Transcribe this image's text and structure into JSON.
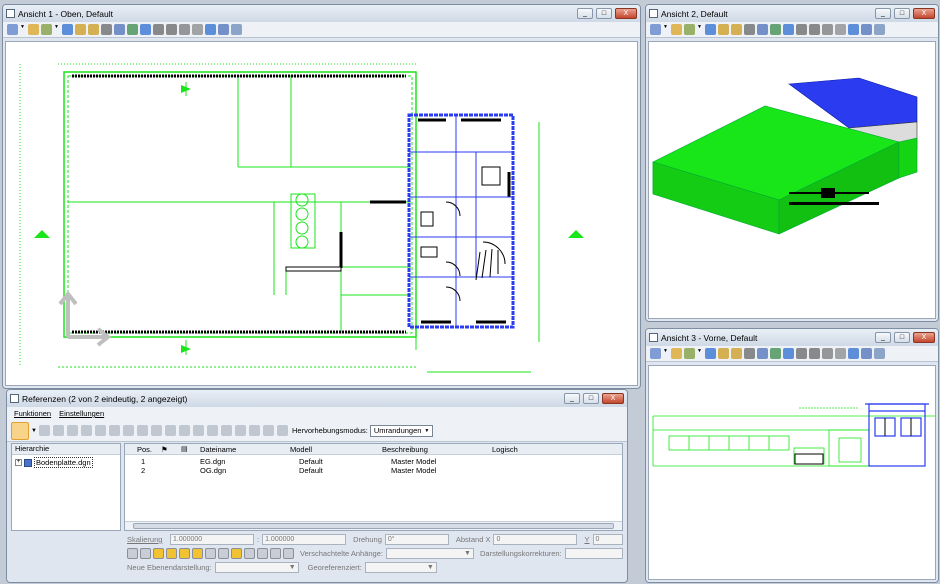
{
  "view1": {
    "title": "Ansicht 1 - Oben, Default"
  },
  "view2": {
    "title": "Ansicht 2, Default"
  },
  "view3": {
    "title": "Ansicht 3 - Vorne, Default"
  },
  "window_buttons": {
    "minimize": "_",
    "maximize": "□",
    "close": "X"
  },
  "references": {
    "title": "Referenzen (2 von 2 eindeutig, 2 angezeigt)",
    "menu": [
      "Funktionen",
      "Einstellungen"
    ],
    "highlight_label": "Hervorhebungsmodus:",
    "highlight_value": "Umrandungen",
    "hierarchy_header": "Hierarchie",
    "tree_item": "Bodenplatte.dgn",
    "columns": [
      "Pos.",
      "Dateiname",
      "Modell",
      "Beschreibung",
      "Logisch"
    ],
    "rows": [
      {
        "pos": "1",
        "file": "EG.dgn",
        "model": "Default",
        "desc": "Master Model",
        "logic": ""
      },
      {
        "pos": "2",
        "file": "OG.dgn",
        "model": "Default",
        "desc": "Master Model",
        "logic": ""
      }
    ],
    "props": {
      "scale_label": "Skalierung",
      "scale1": "1.000000",
      "scale2": "1.000000",
      "rotation_label": "Drehung",
      "rotation": "0°",
      "offset_x_label": "Abstand X",
      "offset_x": "0",
      "y_label": "Y",
      "y": "0",
      "nested_label": "Verschachtelte Anhänge:",
      "display_corr_label": "Darstellungskorrekturen:",
      "new_level_label": "Neue Ebenendarstellung:",
      "georef_label": "Georeferenziert:"
    }
  },
  "colors": {
    "green": "#19e619",
    "blue": "#2a3bf0",
    "accent": "#f1c232"
  }
}
